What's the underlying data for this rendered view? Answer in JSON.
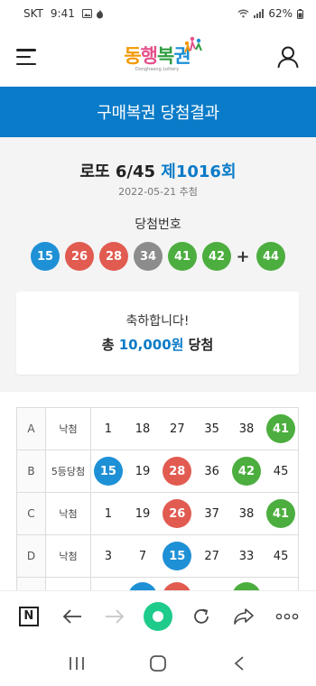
{
  "status_bar": {
    "carrier": "SKT",
    "time": "9:41",
    "battery": "62%"
  },
  "colors": {
    "brand_blue": "#0a7bc8",
    "ball_blue": "#1e90d6",
    "ball_red": "#e15b51",
    "ball_gray": "#8c8c8c",
    "ball_green": "#4cae3f"
  },
  "header": {
    "logo_text": "동행복권",
    "logo_sub": "Donghaeng Lottery",
    "menu_icon": "hamburger-menu-icon",
    "user_icon": "user-account-icon"
  },
  "page_title": "구매복권 당첨결과",
  "draw": {
    "game": "로또 6/45",
    "round": "제1016회",
    "date": "2022-05-21 추첨",
    "winning_label": "당첨번호",
    "winning_numbers": [
      {
        "n": "15",
        "color": "#1e90d6"
      },
      {
        "n": "26",
        "color": "#e15b51"
      },
      {
        "n": "28",
        "color": "#e15b51"
      },
      {
        "n": "34",
        "color": "#8c8c8c"
      },
      {
        "n": "41",
        "color": "#4cae3f"
      },
      {
        "n": "42",
        "color": "#4cae3f"
      }
    ],
    "plus": "+",
    "bonus": {
      "n": "44",
      "color": "#4cae3f"
    }
  },
  "result": {
    "congrats": "축하합니다!",
    "prefix": "총",
    "amount": "10,000원",
    "suffix": "당첨"
  },
  "ticket": {
    "rows": [
      {
        "line": "A",
        "result": "낙첨",
        "numbers": [
          {
            "n": "1",
            "color": ""
          },
          {
            "n": "18",
            "color": ""
          },
          {
            "n": "27",
            "color": ""
          },
          {
            "n": "35",
            "color": ""
          },
          {
            "n": "38",
            "color": ""
          },
          {
            "n": "41",
            "color": "#4cae3f"
          }
        ]
      },
      {
        "line": "B",
        "result": "5등당첨",
        "numbers": [
          {
            "n": "15",
            "color": "#1e90d6"
          },
          {
            "n": "19",
            "color": ""
          },
          {
            "n": "28",
            "color": "#e15b51"
          },
          {
            "n": "36",
            "color": ""
          },
          {
            "n": "42",
            "color": "#4cae3f"
          },
          {
            "n": "45",
            "color": ""
          }
        ]
      },
      {
        "line": "C",
        "result": "낙첨",
        "numbers": [
          {
            "n": "1",
            "color": ""
          },
          {
            "n": "19",
            "color": ""
          },
          {
            "n": "26",
            "color": "#e15b51"
          },
          {
            "n": "37",
            "color": ""
          },
          {
            "n": "38",
            "color": ""
          },
          {
            "n": "41",
            "color": "#4cae3f"
          }
        ]
      },
      {
        "line": "D",
        "result": "낙첨",
        "numbers": [
          {
            "n": "3",
            "color": ""
          },
          {
            "n": "7",
            "color": ""
          },
          {
            "n": "15",
            "color": "#1e90d6"
          },
          {
            "n": "27",
            "color": ""
          },
          {
            "n": "33",
            "color": ""
          },
          {
            "n": "45",
            "color": ""
          }
        ]
      },
      {
        "line": "",
        "result": "",
        "numbers": [
          {
            "n": "",
            "color": ""
          },
          {
            "n": "",
            "color": "#1e90d6"
          },
          {
            "n": "",
            "color": "#e15b51"
          },
          {
            "n": "",
            "color": ""
          },
          {
            "n": "",
            "color": "#4cae3f"
          },
          {
            "n": "",
            "color": ""
          }
        ]
      }
    ]
  },
  "browser_toolbar": {
    "icons": [
      "naver-n-icon",
      "back-arrow-icon",
      "forward-arrow-icon",
      "home-dot-icon",
      "refresh-icon",
      "share-icon",
      "more-dots-icon"
    ]
  },
  "nav_bar": {
    "icons": [
      "recent-apps-icon",
      "home-icon",
      "back-icon"
    ]
  }
}
